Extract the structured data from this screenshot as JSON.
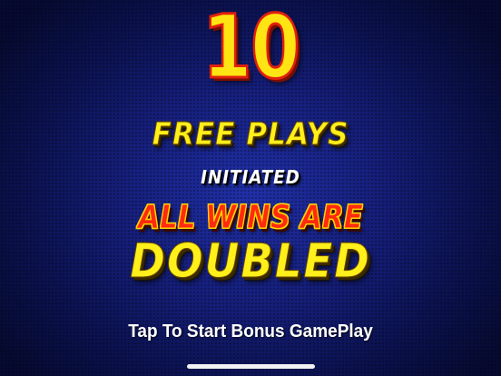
{
  "bonus": {
    "count": "10",
    "line1": "FREE PLAYS",
    "line2": "INITIATED",
    "line3": "ALL WINS ARE",
    "line4": "DOUBLED"
  },
  "prompt": {
    "label": "Tap To Start Bonus GamePlay"
  },
  "colors": {
    "background": "#16207e",
    "yellow_text": "#ffef1a",
    "red_text": "#ff2a10",
    "white_text": "#ffffff"
  }
}
